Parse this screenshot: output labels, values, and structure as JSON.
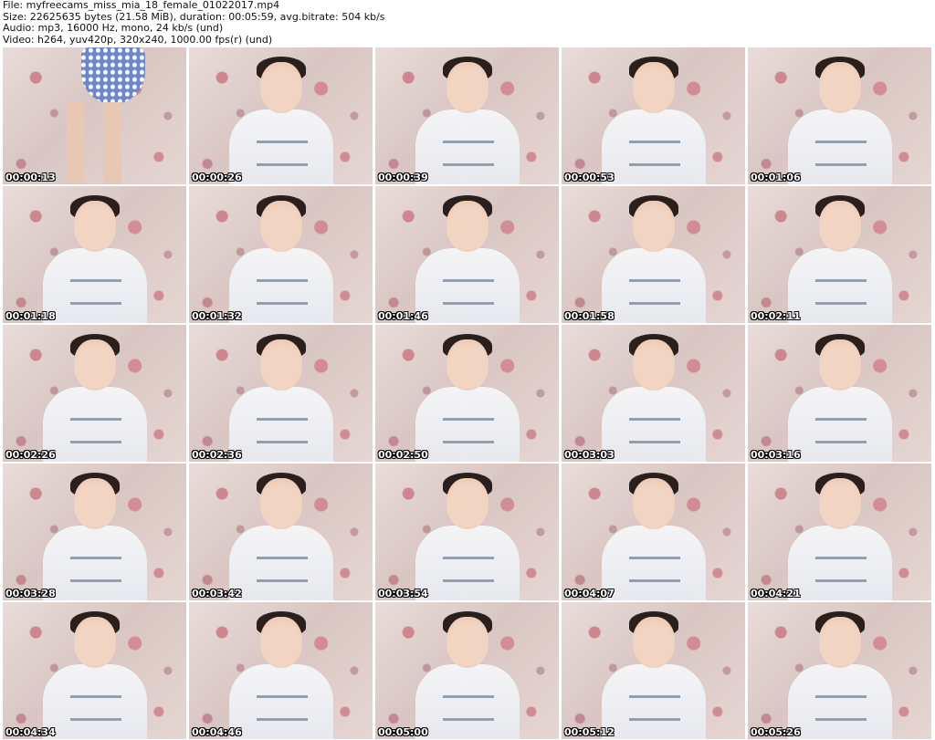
{
  "header": {
    "file": "File: myfreecams_miss_mia_18_female_01022017.mp4",
    "size": "Size: 22625635 bytes (21.58 MiB), duration: 00:05:59, avg.bitrate: 504 kb/s",
    "audio": "Audio: mp3, 16000 Hz, mono, 24 kb/s (und)",
    "video": "Video: h264, yuv420p, 320x240, 1000.00 fps(r) (und)"
  },
  "thumbnails": [
    {
      "timestamp": "00:00:13"
    },
    {
      "timestamp": "00:00:26"
    },
    {
      "timestamp": "00:00:39"
    },
    {
      "timestamp": "00:00:53"
    },
    {
      "timestamp": "00:01:06"
    },
    {
      "timestamp": "00:01:18"
    },
    {
      "timestamp": "00:01:32"
    },
    {
      "timestamp": "00:01:46"
    },
    {
      "timestamp": "00:01:58"
    },
    {
      "timestamp": "00:02:11"
    },
    {
      "timestamp": "00:02:26"
    },
    {
      "timestamp": "00:02:36"
    },
    {
      "timestamp": "00:02:50"
    },
    {
      "timestamp": "00:03:03"
    },
    {
      "timestamp": "00:03:16"
    },
    {
      "timestamp": "00:03:28"
    },
    {
      "timestamp": "00:03:42"
    },
    {
      "timestamp": "00:03:54"
    },
    {
      "timestamp": "00:04:07"
    },
    {
      "timestamp": "00:04:21"
    },
    {
      "timestamp": "00:04:34"
    },
    {
      "timestamp": "00:04:46"
    },
    {
      "timestamp": "00:05:00"
    },
    {
      "timestamp": "00:05:12"
    },
    {
      "timestamp": "00:05:26"
    }
  ]
}
